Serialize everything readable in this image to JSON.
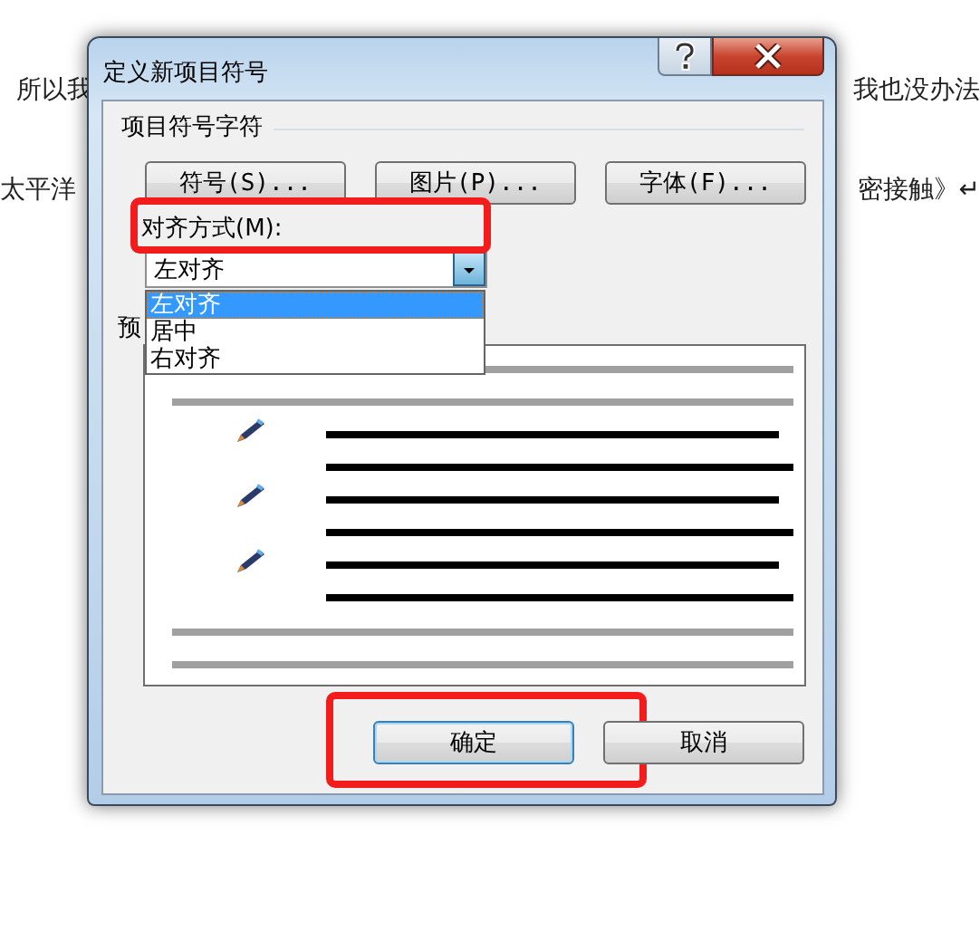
{
  "document": {
    "lines": [
      {
        "left": "所以我",
        "right": "我也没办法"
      },
      {
        "left": "太平洋",
        "right": "密接触》↵"
      }
    ]
  },
  "dialog": {
    "title": "定义新项目符号",
    "group": {
      "title": "项目符号字符",
      "buttons": [
        "符号(S)...",
        "图片(P)...",
        "字体(F)..."
      ]
    },
    "alignment": {
      "label": "对齐方式(M):",
      "value": "左对齐",
      "expanded": true,
      "highlighted": true,
      "options": [
        {
          "label": "左对齐",
          "selected": true
        },
        {
          "label": "居中",
          "selected": false
        },
        {
          "label": "右对齐",
          "selected": false
        }
      ]
    },
    "preview": {
      "label": "预"
    },
    "buttons": [
      {
        "label": "确定",
        "default": true,
        "highlighted": true
      },
      {
        "label": "取消",
        "default": false,
        "highlighted": false
      }
    ]
  }
}
